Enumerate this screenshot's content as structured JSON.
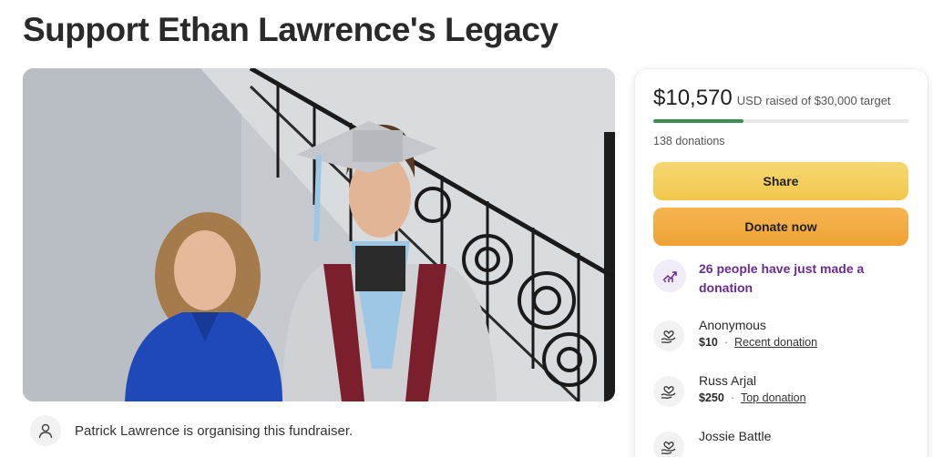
{
  "page": {
    "title": "Support Ethan Lawrence's Legacy"
  },
  "organiser": {
    "text": "Patrick Lawrence is organising this fundraiser.",
    "icon": "person-icon"
  },
  "stats": {
    "raised_amount": "$10,570",
    "currency": "USD",
    "raised_suffix": "raised of $30,000 target",
    "progress_fraction": 0.352,
    "donation_count": "138 donations"
  },
  "buttons": {
    "share": "Share",
    "donate": "Donate now"
  },
  "trend": {
    "text": "26 people have just made a donation",
    "icon": "trending-up-icon"
  },
  "donations": [
    {
      "name": "Anonymous",
      "amount": "$10",
      "tag": "Recent donation",
      "icon": "heart-hand-icon"
    },
    {
      "name": "Russ Arjal",
      "amount": "$250",
      "tag": "Top donation",
      "icon": "heart-hand-icon"
    },
    {
      "name": "Jossie Battle",
      "amount": "",
      "tag": "",
      "icon": "heart-hand-icon"
    }
  ],
  "colors": {
    "accent_purple": "#6a2c91",
    "progress_green": "#3b8f55",
    "share_yellow": "#f1c84b",
    "donate_orange": "#efa234"
  }
}
